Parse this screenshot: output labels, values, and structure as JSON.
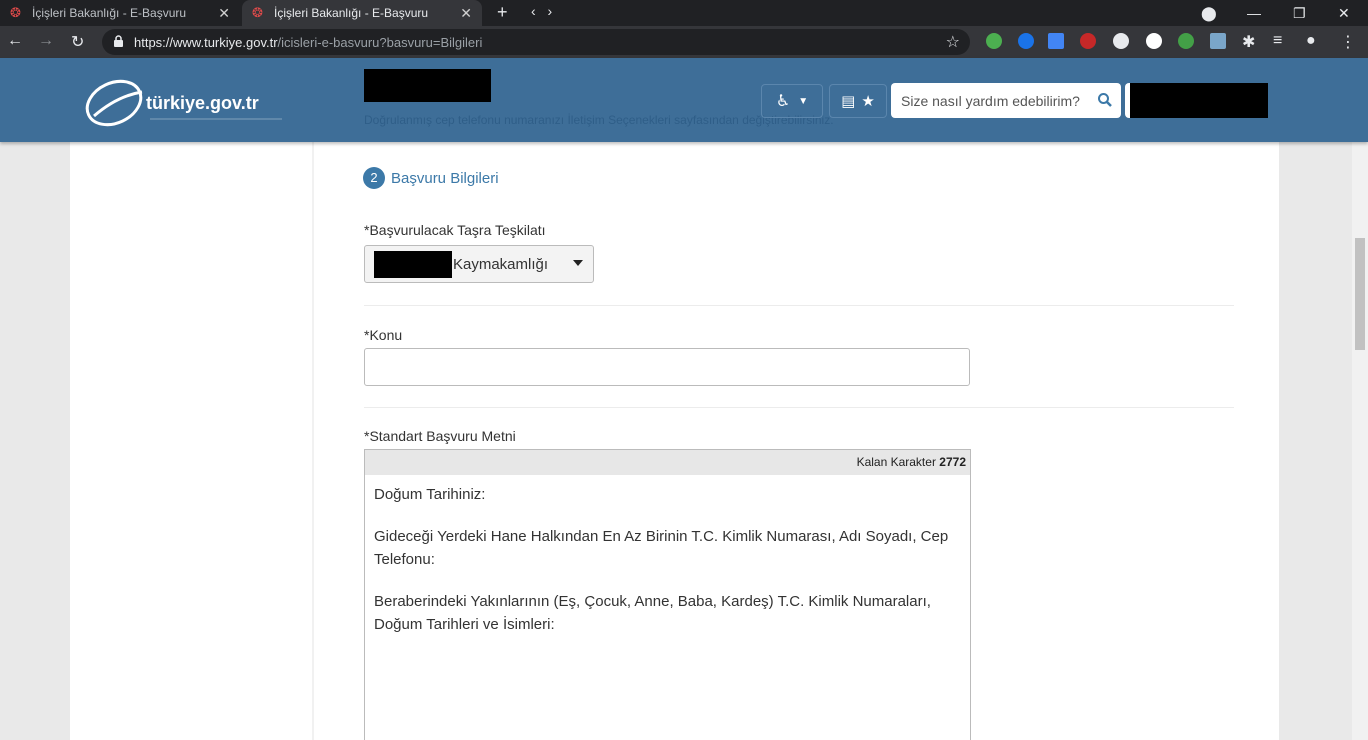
{
  "browser": {
    "tabs": [
      {
        "title": "İçişleri Bakanlığı - E-Başvuru",
        "active": false
      },
      {
        "title": "İçişleri Bakanlığı - E-Başvuru",
        "active": true
      }
    ],
    "url_host": "https://www.turkiye.gov.tr",
    "url_path": "/icisleri-e-basvuru?basvuru=Bilgileri"
  },
  "header": {
    "logo_text": "türkiye.gov.tr",
    "ghost_text": "Doğrulanmış cep telefonu numaranızı İletişim Seçenekleri sayfasından değiştirebilirsiniz.",
    "search_placeholder": "Size nasıl yardım edebilirim?"
  },
  "form": {
    "step_number": "2",
    "step_title": "Başvuru Bilgileri",
    "org_label": "*Başvurulacak Taşra Teşkilatı",
    "org_value": "Kaymakamlığı",
    "subject_label": "*Konu",
    "subject_value": "",
    "text_label": "*Standart Başvuru Metni",
    "counter_label": "Kalan Karakter",
    "counter_value": "2772",
    "text_lines": [
      "Doğum Tarihiniz:",
      "Gideceği Yerdeki Hane Halkından En Az Birinin T.C. Kimlik Numarası, Adı Soyadı, Cep Telefonu:",
      "Beraberindeki Yakınlarının (Eş, Çocuk, Anne, Baba, Kardeş) T.C. Kimlik Numaraları, Doğum Tarihleri ve İsimleri:"
    ]
  },
  "colors": {
    "header_blue": "#3e6e98",
    "accent_blue": "#3c79a8"
  }
}
